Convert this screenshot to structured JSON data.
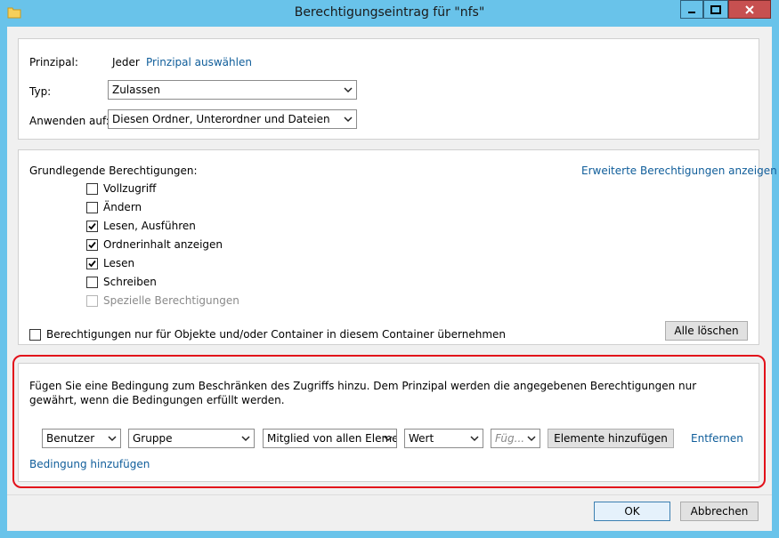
{
  "window": {
    "title": "Berechtigungseintrag für \"nfs\""
  },
  "principal": {
    "label": "Prinzipal:",
    "value": "Jeder",
    "select_link": "Prinzipal auswählen"
  },
  "type": {
    "label": "Typ:",
    "value": "Zulassen"
  },
  "apply_to": {
    "label": "Anwenden auf:",
    "value": "Diesen Ordner, Unterordner und Dateien"
  },
  "permissions": {
    "heading": "Grundlegende Berechtigungen:",
    "advanced_link": "Erweiterte Berechtigungen anzeigen",
    "items": [
      {
        "label": "Vollzugriff",
        "checked": false,
        "enabled": true
      },
      {
        "label": "Ändern",
        "checked": false,
        "enabled": true
      },
      {
        "label": "Lesen, Ausführen",
        "checked": true,
        "enabled": true
      },
      {
        "label": "Ordnerinhalt anzeigen",
        "checked": true,
        "enabled": true
      },
      {
        "label": "Lesen",
        "checked": true,
        "enabled": true
      },
      {
        "label": "Schreiben",
        "checked": false,
        "enabled": true
      },
      {
        "label": "Spezielle Berechtigungen",
        "checked": false,
        "enabled": false
      }
    ],
    "inherit_only": {
      "label": "Berechtigungen nur für Objekte und/oder Container in diesem Container übernehmen",
      "checked": false
    },
    "clear_all": "Alle löschen"
  },
  "condition": {
    "description": "Fügen Sie eine Bedingung zum Beschränken des Zugriffs hinzu. Dem Prinzipal werden die angegebenen Berechtigungen nur gewährt, wenn die Bedingungen erfüllt werden.",
    "subject": "Benutzer",
    "attribute": "Gruppe",
    "operator": "Mitglied von allen Eleme",
    "value_type": "Wert",
    "value_placeholder": "Füg...",
    "add_items": "Elemente hinzufügen",
    "remove": "Entfernen",
    "add_condition": "Bedingung hinzufügen"
  },
  "buttons": {
    "ok": "OK",
    "cancel": "Abbrechen"
  }
}
